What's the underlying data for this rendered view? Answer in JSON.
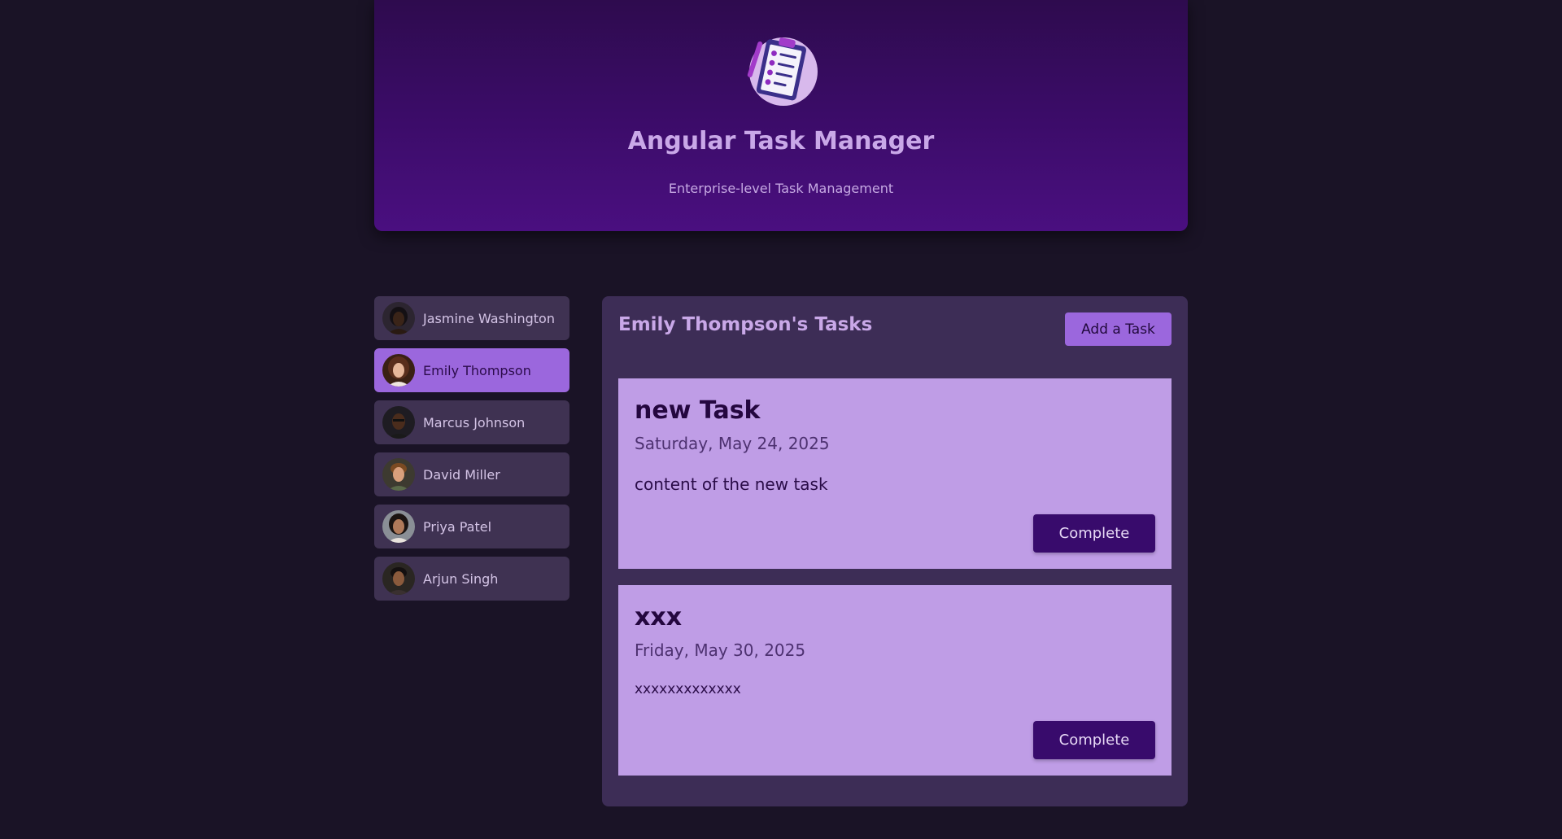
{
  "header": {
    "title": "Angular Task Manager",
    "subtitle": "Enterprise-level Task Management",
    "logo_icon": "clipboard-checklist-icon"
  },
  "users": [
    {
      "name": "Jasmine Washington",
      "selected": false
    },
    {
      "name": "Emily Thompson",
      "selected": true
    },
    {
      "name": "Marcus Johnson",
      "selected": false
    },
    {
      "name": "David Miller",
      "selected": false
    },
    {
      "name": "Priya Patel",
      "selected": false
    },
    {
      "name": "Arjun Singh",
      "selected": false
    }
  ],
  "tasks_panel": {
    "title": "Emily Thompson's Tasks",
    "add_label": "Add a Task",
    "tasks": [
      {
        "title": "new Task",
        "date": "Saturday, May 24, 2025",
        "content": "content of the new task",
        "complete_label": "Complete"
      },
      {
        "title": "xxx",
        "date": "Friday, May 30, 2025",
        "content": "xxxxxxxxxxxxx",
        "complete_label": "Complete"
      }
    ]
  },
  "colors": {
    "page_bg": "#1a1326",
    "header_top": "#2e0b4e",
    "header_bottom": "#4a0f80",
    "accent": "#9b67dd",
    "panel_bg": "#3d2d56",
    "task_bg": "#bf9de6",
    "button_dark": "#380b6c"
  }
}
